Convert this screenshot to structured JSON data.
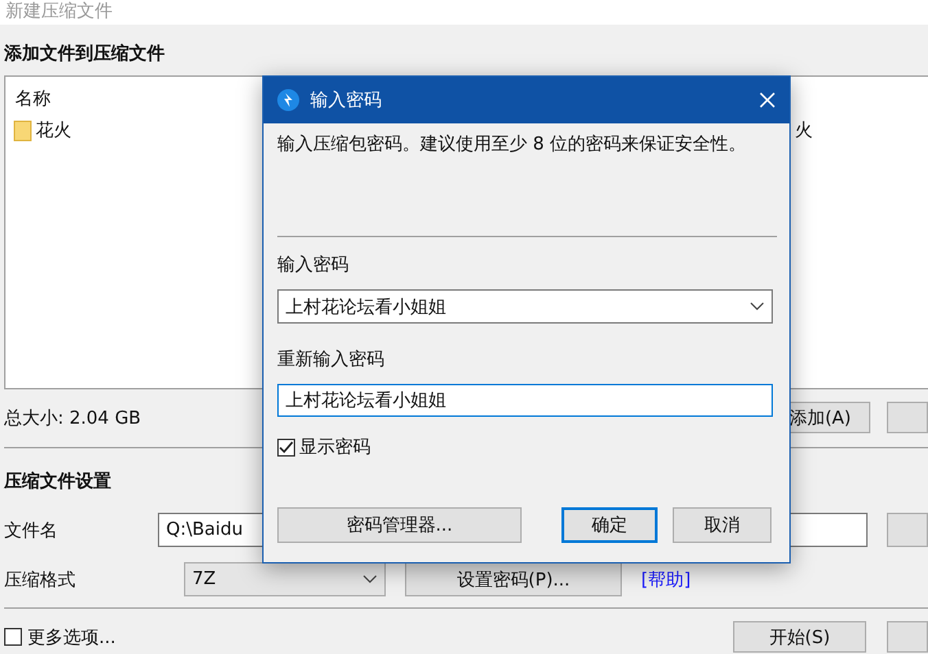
{
  "window": {
    "title": "新建压缩文件"
  },
  "files": {
    "heading": "添加文件到压缩文件",
    "columns": [
      "名称"
    ],
    "rows": [
      {
        "name": "花火",
        "column_2": "火"
      }
    ]
  },
  "total_size": "总大小: 2.04 GB",
  "add_button": "添加(A)",
  "settings": {
    "heading": "压缩文件设置",
    "filename_label": "文件名",
    "filename": "Q:\\Baidu",
    "format_label": "压缩格式",
    "format": "7Z",
    "password_button": "设置密码(P)...",
    "help_link": "[帮助]"
  },
  "more_options": {
    "label": "更多选项...",
    "checked": false
  },
  "start_button": "开始(S)",
  "dialog": {
    "title": "输入密码",
    "message": "输入压缩包密码。建议使用至少 8 位的密码来保证安全性。",
    "password_label": "输入密码",
    "password": "上村花论坛看小姐姐",
    "confirm_label": "重新输入密码",
    "confirm": "上村花论坛看小姐姐",
    "show_password": {
      "label": "显示密码",
      "checked": true
    },
    "buttons": [
      {
        "label": "密码管理器...",
        "default": false
      },
      {
        "label": "确定",
        "default": true
      },
      {
        "label": "取消",
        "default": false
      }
    ]
  }
}
